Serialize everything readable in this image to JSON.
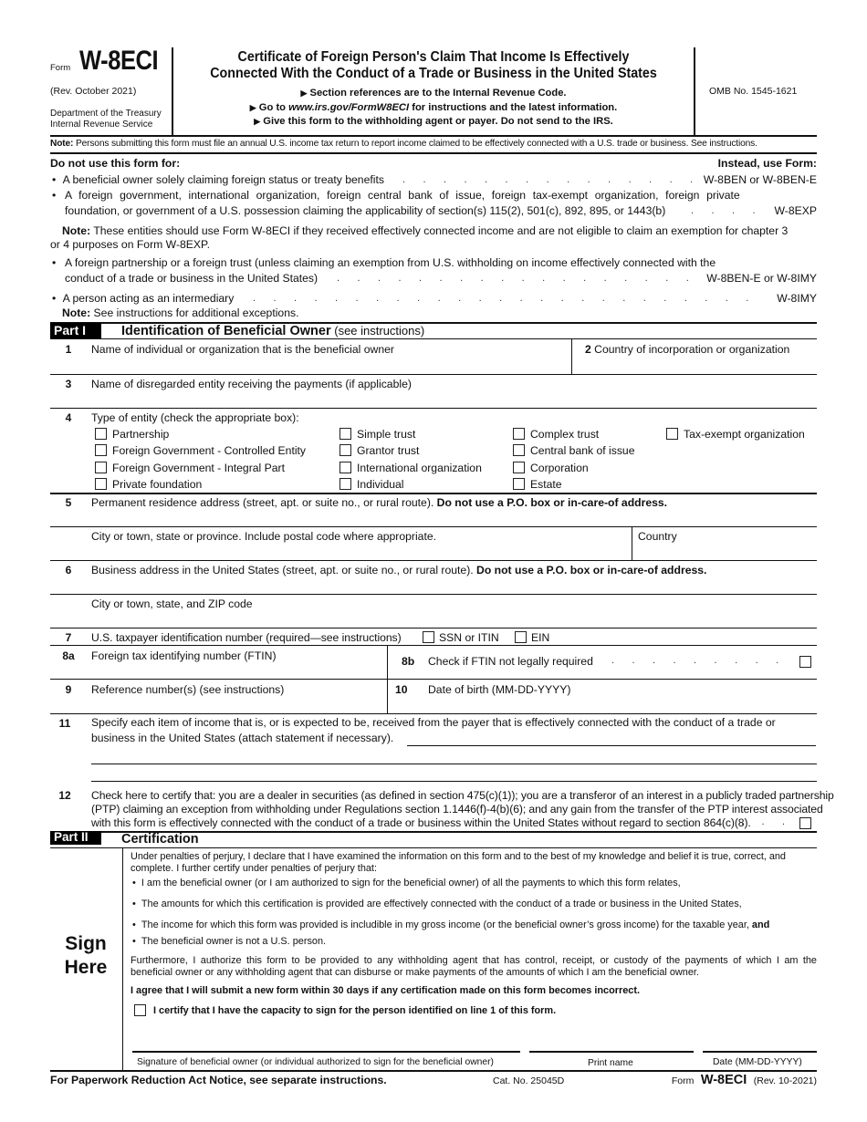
{
  "header": {
    "form_prefix": "Form",
    "form_number": "W-8ECI",
    "revision": "(Rev. October 2021)",
    "department": "Department of the Treasury",
    "agency": "Internal Revenue Service",
    "title_line1": "Certificate of Foreign Person's Claim That Income Is Effectively",
    "title_line2": "Connected With the Conduct of a Trade or Business in the United States",
    "instruction1": "Section references are to the Internal Revenue Code.",
    "instruction2_pre": "Go to ",
    "instruction2_url": "www.irs.gov/FormW8ECI",
    "instruction2_post": " for instructions and the latest information.",
    "instruction3": "Give this form to the withholding agent or payer. Do not send to the IRS.",
    "omb": "OMB No. 1545-1621",
    "arrow": "▶"
  },
  "note_top": {
    "label": "Note:",
    "text": " Persons submitting this form must file an annual U.S. income tax return to report income claimed to be effectively connected with a U.S. trade or business. See instructions."
  },
  "do_not_use": {
    "heading": "Do not use this form for:",
    "instead_heading": "Instead, use Form:",
    "bullet": "•",
    "items": [
      {
        "text": "A beneficial owner solely claiming foreign status or treaty benefits",
        "form": "W-8BEN or W-8BEN-E"
      },
      {
        "text_line1": "A foreign government, international organization, foreign central bank of issue, foreign tax-exempt organization, foreign private",
        "text_line2": "foundation, or government of a U.S. possession claiming the applicability of section(s) 115(2), 501(c), 892, 895, or 1443(b)",
        "form": "W-8EXP"
      },
      {
        "text_line1": "A foreign partnership or a foreign trust (unless claiming an exemption from U.S. withholding on income effectively connected with the",
        "text_line2": "conduct of a trade or business in the United States)",
        "form": "W-8BEN-E or W-8IMY"
      },
      {
        "text": "A person acting as an intermediary",
        "form": "W-8IMY"
      }
    ],
    "note_entities_label": "Note:",
    "note_entities_line1": " These entities should use Form W-8ECI if they received effectively connected income and are not eligible to claim an exemption for chapter 3",
    "note_entities_line2": "or 4 purposes on Form W-8EXP.",
    "note_exceptions_label": "Note:",
    "note_exceptions_text": " See instructions for additional exceptions."
  },
  "part1": {
    "badge": "Part I",
    "title": "Identification of Beneficial Owner",
    "title_suffix": " (see instructions)",
    "line1": {
      "num": "1",
      "label": "Name of individual or organization that is the beneficial owner",
      "value": ""
    },
    "line2": {
      "num": "2",
      "label": " Country of incorporation or organization",
      "value": ""
    },
    "line3": {
      "num": "3",
      "label": "Name of disregarded entity receiving the payments (if applicable)",
      "value": ""
    },
    "line4": {
      "num": "4",
      "label": "Type of entity (check the appropriate box):",
      "options": [
        {
          "label": "Partnership",
          "checked": false
        },
        {
          "label": "Foreign Government - Controlled Entity",
          "checked": false
        },
        {
          "label": "Foreign Government - Integral Part",
          "checked": false
        },
        {
          "label": "Private foundation",
          "checked": false
        },
        {
          "label": "Simple trust",
          "checked": false
        },
        {
          "label": "Grantor trust",
          "checked": false
        },
        {
          "label": "International organization",
          "checked": false
        },
        {
          "label": "Individual",
          "checked": false
        },
        {
          "label": "Complex trust",
          "checked": false
        },
        {
          "label": "Central bank of issue",
          "checked": false
        },
        {
          "label": "Corporation",
          "checked": false
        },
        {
          "label": "Estate",
          "checked": false
        },
        {
          "label": "Tax-exempt organization",
          "checked": false
        }
      ]
    },
    "line5": {
      "num": "5",
      "label": "Permanent residence address (street, apt. or suite no., or rural route). ",
      "label_bold": "Do not use a P.O. box or in-care-of address.",
      "value": ""
    },
    "line5_city": {
      "label": "City or town, state or province. Include postal code where appropriate.",
      "value": ""
    },
    "line5_country": {
      "label": "Country",
      "value": ""
    },
    "line6": {
      "num": "6",
      "label": "Business address in the United States (street, apt. or suite no., or rural route). ",
      "label_bold": "Do not use a P.O. box or in-care-of address.",
      "value": ""
    },
    "line6_city": {
      "label": "City or town, state, and ZIP code",
      "value": ""
    },
    "line7": {
      "num": "7",
      "label": "U.S. taxpayer identification number (required—see instructions)",
      "opt_ssn": "SSN or ITIN",
      "opt_ein": "EIN",
      "value": ""
    },
    "line8a": {
      "num": "8a",
      "label": "Foreign tax identifying number (FTIN)",
      "value": ""
    },
    "line8b": {
      "num": "8b",
      "label": "Check if FTIN not legally required",
      "checked": false
    },
    "line9": {
      "num": "9",
      "label": "Reference number(s) (see instructions)",
      "value": ""
    },
    "line10": {
      "num": "10",
      "label": "Date of birth (MM-DD-YYYY)",
      "value": ""
    },
    "line11": {
      "num": "11",
      "label_line1": "Specify each item of income that is, or is expected to be, received from the payer that is effectively connected with the conduct of a trade or",
      "label_line2": "business in the United States (attach statement if necessary).",
      "value": ""
    },
    "line12": {
      "num": "12",
      "label_line1": "Check here to certify that: you are a dealer in securities (as defined in section 475(c)(1)); you are a transferor of an interest in a publicly traded partnership",
      "label_line2": "(PTP) claiming an exception from withholding under Regulations section 1.1446(f)-4(b)(6); and any gain from the transfer of the PTP interest associated",
      "label_line3": "with this form is effectively connected with the conduct of a trade or business within the United States without regard to section 864(c)(8).",
      "checked": false
    }
  },
  "part2": {
    "badge": "Part II",
    "title": "Certification",
    "sign_here_line1": "Sign",
    "sign_here_line2": "Here",
    "intro_line1": "Under penalties of perjury, I declare that I have examined the information on this form and to the best of my knowledge and belief it is true, correct, and",
    "intro_line2": "complete. I further certify under penalties of perjury that:",
    "bullets": [
      "I am the beneficial owner (or I am authorized to sign for the beneficial owner) of all the payments to which this form relates,",
      "The amounts for which this certification is provided are effectively connected with the conduct of a trade or business in the United States,",
      "The income for which this form was provided is includible in my gross income (or the beneficial owner’s gross income) for the taxable year, ",
      "The beneficial owner is not a U.S. person."
    ],
    "bullet3_bold": "and",
    "furthermore_line1": "Furthermore, I authorize this form to be provided to any withholding agent that has control, receipt, or custody of the payments of which I am the",
    "furthermore_line2": "beneficial owner or any withholding agent that can disburse or make payments of the amounts of which I am the beneficial owner.",
    "agree": "I agree that I will submit a new form within 30 days if any certification made on this form becomes incorrect.",
    "capacity": "I certify that I have the capacity to sign for the person identified on line 1 of this form.",
    "capacity_checked": false,
    "signature_label": "Signature of beneficial owner (or individual authorized to sign for the beneficial owner)",
    "print_name_label": "Print name",
    "date_label": "Date (MM-DD-YYYY)",
    "signature_value": "",
    "print_name_value": "",
    "date_value": ""
  },
  "footer": {
    "paperwork": "For Paperwork Reduction Act Notice, see separate instructions.",
    "cat_no": "Cat. No. 25045D",
    "form_prefix": "Form",
    "form_number": "W-8ECI",
    "revision": "(Rev. 10-2021)"
  }
}
